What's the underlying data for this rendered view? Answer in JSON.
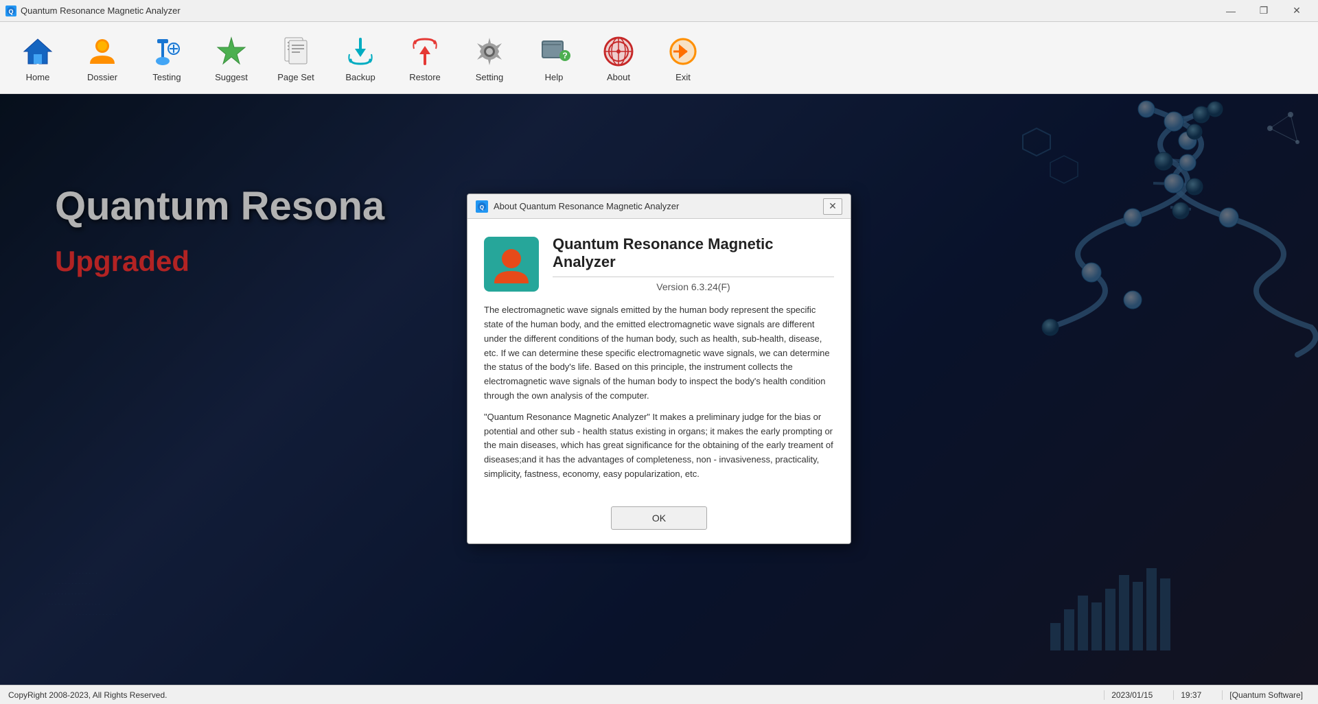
{
  "app": {
    "title": "Quantum Resonance Magnetic Analyzer",
    "icon_label": "Q"
  },
  "titlebar": {
    "minimize_label": "—",
    "maximize_label": "❐",
    "close_label": "✕"
  },
  "toolbar": {
    "items": [
      {
        "id": "home",
        "label": "Home",
        "icon": "home"
      },
      {
        "id": "dossier",
        "label": "Dossier",
        "icon": "dossier"
      },
      {
        "id": "testing",
        "label": "Testing",
        "icon": "testing"
      },
      {
        "id": "suggest",
        "label": "Suggest",
        "icon": "suggest"
      },
      {
        "id": "page_set",
        "label": "Page Set",
        "icon": "pageset"
      },
      {
        "id": "backup",
        "label": "Backup",
        "icon": "backup"
      },
      {
        "id": "restore",
        "label": "Restore",
        "icon": "restore"
      },
      {
        "id": "setting",
        "label": "Setting",
        "icon": "setting"
      },
      {
        "id": "help",
        "label": "Help",
        "icon": "help"
      },
      {
        "id": "about",
        "label": "About",
        "icon": "about"
      },
      {
        "id": "exit",
        "label": "Exit",
        "icon": "exit"
      }
    ]
  },
  "background": {
    "main_title": "Quantum Resona",
    "subtitle": "Upgraded"
  },
  "modal": {
    "title": "About Quantum Resonance Magnetic Analyzer",
    "app_name": "Quantum Resonance Magnetic Analyzer",
    "version": "Version 6.3.24(F)",
    "description_1": "The electromagnetic wave signals emitted by the human body represent the specific state of the human body, and the emitted electromagnetic wave signals are different under the different conditions of the human body, such as health, sub-health, disease, etc. If we can determine these specific electromagnetic wave signals, we can determine the status of the body's life. Based on this principle, the instrument collects the electromagnetic wave signals of the human body to inspect the body's health condition through the own analysis of the computer.",
    "description_2": "\"Quantum Resonance Magnetic Analyzer\" It makes a preliminary judge for the bias or potential and other sub - health status existing in organs; it makes the early prompting or the main diseases, which has great significance for the obtaining of the early treament of diseases;and it has the advantages of completeness, non - invasiveness, practicality, simplicity, fastness, economy, easy popularization, etc.",
    "ok_label": "OK"
  },
  "statusbar": {
    "copyright": "CopyRight 2008-2023, All Rights Reserved.",
    "date": "2023/01/15",
    "time": "19:37",
    "software": "[Quantum Software]"
  }
}
